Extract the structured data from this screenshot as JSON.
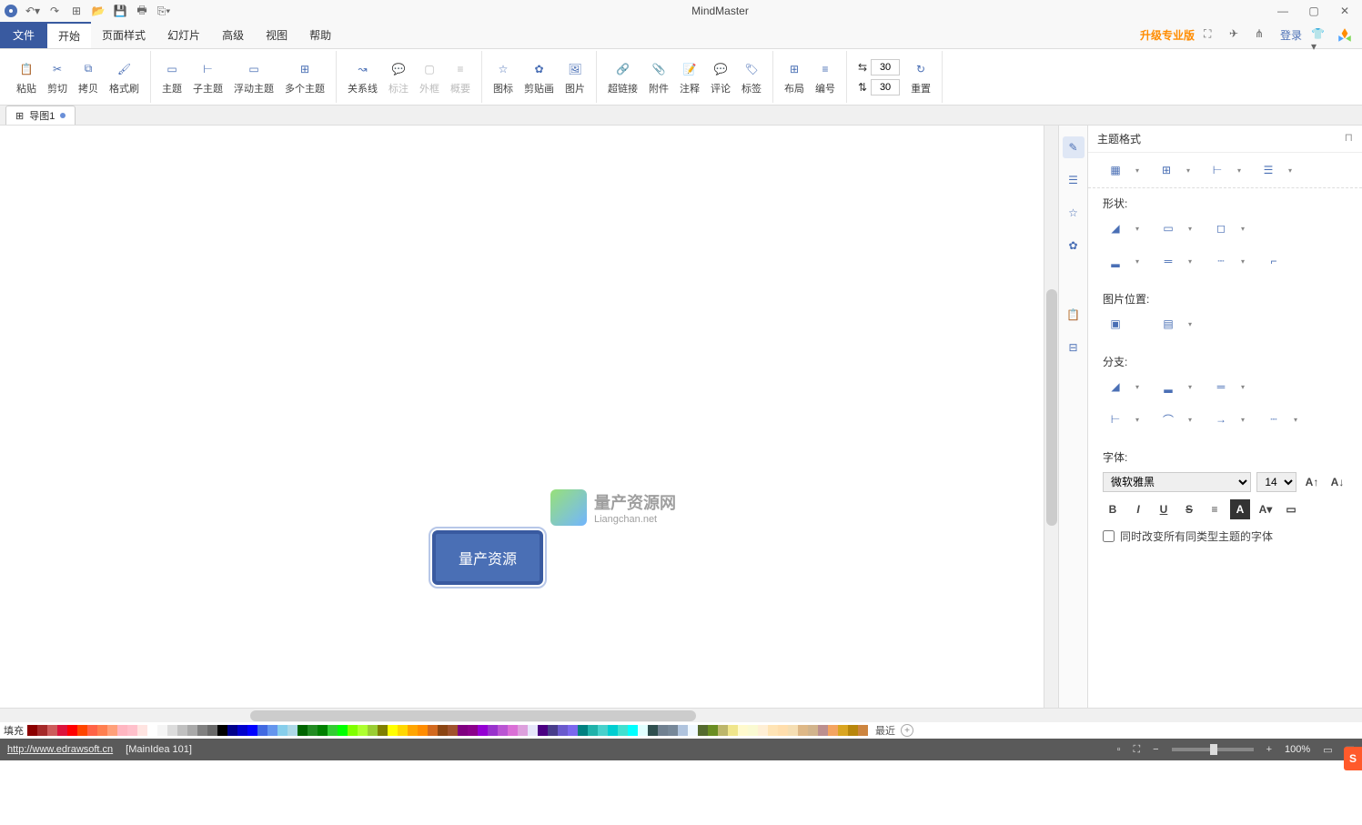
{
  "app_title": "MindMaster",
  "qat": {
    "undo": "↶",
    "redo": "↷"
  },
  "menu": {
    "file": "文件",
    "tabs": [
      "开始",
      "页面样式",
      "幻灯片",
      "高级",
      "视图",
      "帮助"
    ],
    "active": "开始",
    "upgrade": "升级专业版",
    "login": "登录"
  },
  "ribbon": {
    "g1": [
      {
        "k": "paste",
        "l": "粘贴"
      },
      {
        "k": "cut",
        "l": "剪切"
      },
      {
        "k": "copy",
        "l": "拷贝"
      },
      {
        "k": "format-painter",
        "l": "格式刷"
      }
    ],
    "g2": [
      {
        "k": "topic",
        "l": "主题"
      },
      {
        "k": "subtopic",
        "l": "子主题"
      },
      {
        "k": "floating-topic",
        "l": "浮动主题"
      },
      {
        "k": "multi-topic",
        "l": "多个主题"
      }
    ],
    "g3": [
      {
        "k": "relation",
        "l": "关系线"
      },
      {
        "k": "callout",
        "l": "标注",
        "d": true
      },
      {
        "k": "boundary",
        "l": "外框",
        "d": true
      },
      {
        "k": "summary",
        "l": "概要",
        "d": true
      }
    ],
    "g4": [
      {
        "k": "icon",
        "l": "图标"
      },
      {
        "k": "clipart",
        "l": "剪贴画"
      },
      {
        "k": "image",
        "l": "图片"
      }
    ],
    "g5": [
      {
        "k": "hyperlink",
        "l": "超链接"
      },
      {
        "k": "attachment",
        "l": "附件"
      },
      {
        "k": "note",
        "l": "注释"
      },
      {
        "k": "comment",
        "l": "评论"
      },
      {
        "k": "tag",
        "l": "标签"
      }
    ],
    "g6": [
      {
        "k": "layout",
        "l": "布局"
      },
      {
        "k": "number",
        "l": "编号"
      }
    ],
    "spacing": {
      "h": "30",
      "v": "30"
    },
    "reset": "重置"
  },
  "doc_tab": "导图1",
  "canvas": {
    "topic_text": "量产资源",
    "watermark_zh": "量产资源网",
    "watermark_en": "Liangchan.net"
  },
  "format_panel": {
    "title": "主题格式",
    "shape": "形状:",
    "image_pos": "图片位置:",
    "branch": "分支:",
    "font": "字体:",
    "font_name": "微软雅黑",
    "font_size": "14",
    "checkbox": "同时改变所有同类型主题的字体"
  },
  "colorbar": {
    "label": "填充",
    "recent": "最近",
    "colors": [
      "#8B0000",
      "#A52A2A",
      "#CD5C5C",
      "#DC143C",
      "#FF0000",
      "#FF4500",
      "#FF6347",
      "#FF7F50",
      "#FFA07A",
      "#FFB6C1",
      "#FFC0CB",
      "#FFE4E1",
      "#FFFFFF",
      "#F5F5F5",
      "#DCDCDC",
      "#C0C0C0",
      "#A9A9A9",
      "#808080",
      "#696969",
      "#000000",
      "#00008B",
      "#0000CD",
      "#0000FF",
      "#4169E1",
      "#6495ED",
      "#87CEEB",
      "#ADD8E6",
      "#006400",
      "#228B22",
      "#008000",
      "#32CD32",
      "#00FF00",
      "#7FFF00",
      "#ADFF2F",
      "#9ACD32",
      "#808000",
      "#FFFF00",
      "#FFD700",
      "#FFA500",
      "#FF8C00",
      "#D2691E",
      "#8B4513",
      "#A0522D",
      "#800080",
      "#8B008B",
      "#9400D3",
      "#9932CC",
      "#BA55D3",
      "#DA70D6",
      "#DDA0DD",
      "#E6E6FA",
      "#4B0082",
      "#483D8B",
      "#6A5ACD",
      "#7B68EE",
      "#008080",
      "#20B2AA",
      "#48D1CC",
      "#00CED1",
      "#40E0D0",
      "#00FFFF",
      "#E0FFFF",
      "#2F4F4F",
      "#708090",
      "#778899",
      "#B0C4DE",
      "#F0F8FF",
      "#556B2F",
      "#6B8E23",
      "#BDB76B",
      "#F0E68C",
      "#FFFACD",
      "#FAFAD2",
      "#FFEFD5",
      "#FFE4B5",
      "#FFDEAD",
      "#F5DEB3",
      "#DEB887",
      "#D2B48C",
      "#BC8F8F",
      "#F4A460",
      "#DAA520",
      "#B8860B",
      "#CD853F"
    ]
  },
  "status": {
    "url": "http://www.edrawsoft.cn",
    "info": "[MainIdea 101]",
    "zoom": "100%"
  }
}
